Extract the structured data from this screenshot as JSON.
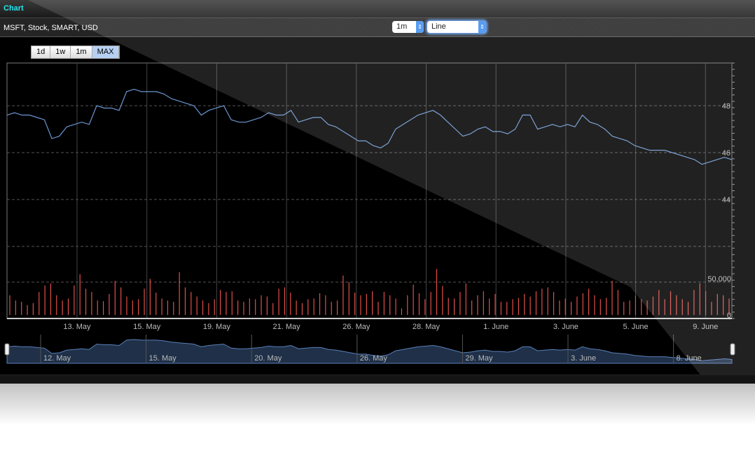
{
  "window": {
    "title": "Chart"
  },
  "toolbar": {
    "symbol": "MSFT, Stock, SMART, USD",
    "period_select": "1m",
    "type_select": "Line"
  },
  "range_buttons": [
    {
      "label": "1d"
    },
    {
      "label": "1w"
    },
    {
      "label": "1m"
    },
    {
      "label": "MAX",
      "active": true
    }
  ],
  "colors": {
    "price_line": "#6a95cf",
    "volume_bar": "#e0504a",
    "navigator_fill": "#1f3048",
    "title": "#1ee8f0"
  },
  "chart_data": {
    "type": "line",
    "x_ticks": [
      "13. May",
      "15. May",
      "19. May",
      "21. May",
      "26. May",
      "28. May",
      "1. June",
      "3. June",
      "5. June",
      "9. June"
    ],
    "price_axis": {
      "ticks": [
        44,
        46,
        48
      ],
      "range": [
        40,
        49.5
      ]
    },
    "volume_axis": {
      "ticks": [
        "0",
        "50,000"
      ],
      "range": [
        0,
        50000
      ]
    },
    "price": [
      47.6,
      47.7,
      47.6,
      47.6,
      47.5,
      47.4,
      46.6,
      46.7,
      47.1,
      47.2,
      47.3,
      47.2,
      48.0,
      47.9,
      47.9,
      47.8,
      48.6,
      48.7,
      48.6,
      48.6,
      48.6,
      48.5,
      48.3,
      48.2,
      48.1,
      48.0,
      47.6,
      47.8,
      47.9,
      48.0,
      47.4,
      47.3,
      47.3,
      47.4,
      47.5,
      47.7,
      47.6,
      47.6,
      47.8,
      47.3,
      47.4,
      47.5,
      47.5,
      47.2,
      47.1,
      46.9,
      46.7,
      46.5,
      46.5,
      46.3,
      46.2,
      46.4,
      47.0,
      47.2,
      47.4,
      47.6,
      47.7,
      47.8,
      47.6,
      47.3,
      47.0,
      46.7,
      46.8,
      47.0,
      47.1,
      46.9,
      46.9,
      46.8,
      47.0,
      47.6,
      47.6,
      47.0,
      47.1,
      47.2,
      47.1,
      47.2,
      47.1,
      47.6,
      47.3,
      47.2,
      47.0,
      46.7,
      46.6,
      46.5,
      46.3,
      46.2,
      46.1,
      46.1,
      46.1,
      46.0,
      45.9,
      45.8,
      45.7,
      45.5,
      45.6,
      45.7,
      45.8,
      45.7
    ],
    "volume": [
      30,
      22,
      20,
      15,
      18,
      35,
      45,
      48,
      30,
      22,
      25,
      45,
      62,
      40,
      35,
      22,
      21,
      32,
      52,
      42,
      28,
      22,
      24,
      40,
      55,
      34,
      25,
      22,
      20,
      65,
      42,
      35,
      28,
      22,
      18,
      24,
      38,
      35,
      36,
      22,
      20,
      25,
      24,
      30,
      28,
      18,
      40,
      42,
      34,
      22,
      18,
      24,
      25,
      33,
      30,
      20,
      22,
      60,
      50,
      34,
      30,
      32,
      36,
      20,
      35,
      30,
      25,
      10,
      30,
      46,
      33,
      24,
      35,
      70,
      44,
      26,
      25,
      35,
      48,
      22,
      30,
      36,
      25,
      32,
      20,
      20,
      24,
      26,
      32,
      28,
      36,
      40,
      42,
      35,
      22,
      25,
      20,
      28,
      33,
      40,
      30,
      24,
      26,
      52,
      38,
      20,
      22,
      30,
      24,
      22,
      28,
      38,
      24,
      36,
      30,
      24,
      20,
      38,
      48,
      36,
      20,
      32,
      30,
      25
    ],
    "navigator_ticks": [
      "12. May",
      "15. May",
      "20. May",
      "26. May",
      "29. May",
      "3. June",
      "8. June"
    ]
  }
}
